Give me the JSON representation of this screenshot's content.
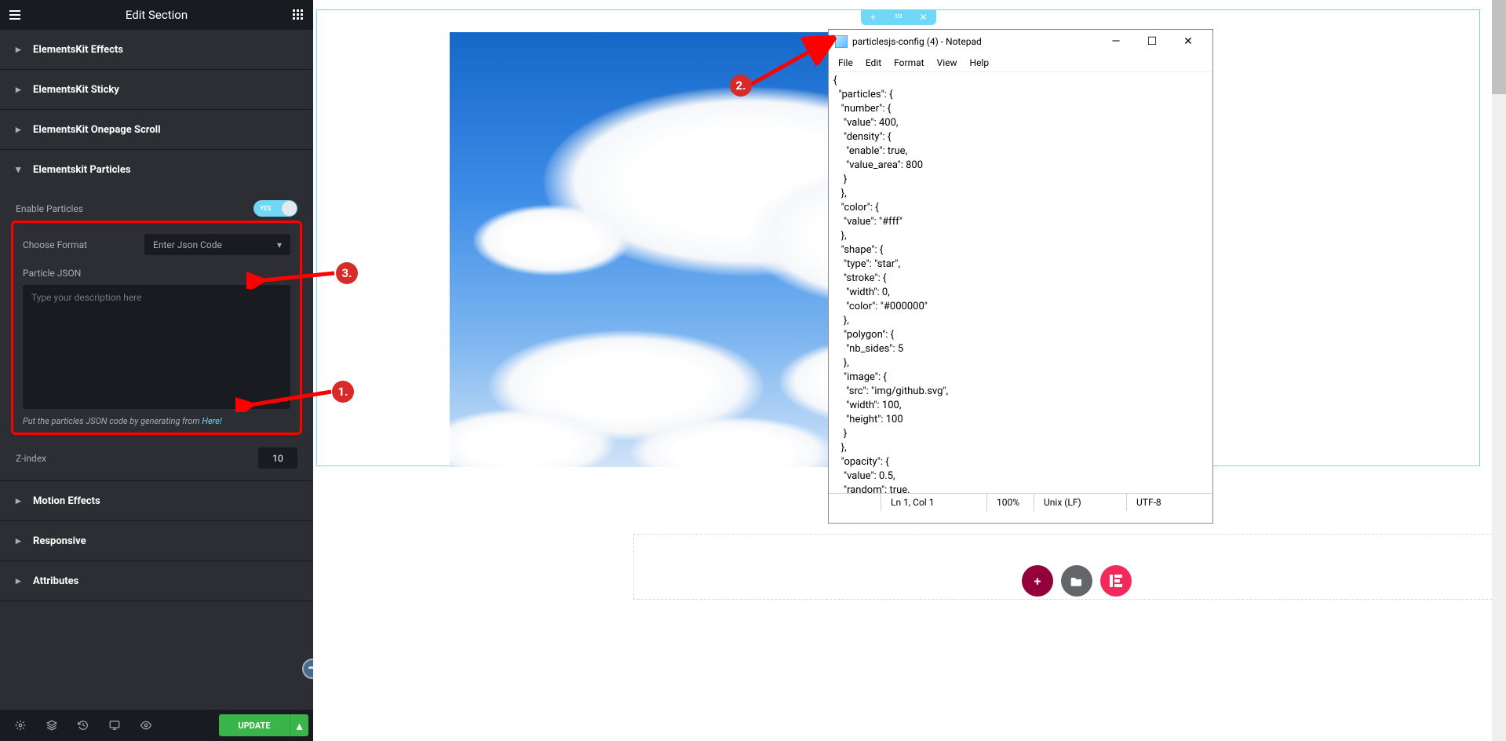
{
  "sidebar": {
    "title": "Edit Section",
    "sections": {
      "effects": "ElementsKit Effects",
      "sticky": "ElementsKit Sticky",
      "onepage": "ElementsKit Onepage Scroll",
      "particles": "Elementskit Particles",
      "motion": "Motion Effects",
      "responsive": "Responsive",
      "attributes": "Attributes"
    },
    "enable_particles_label": "Enable Particles",
    "toggle_yes": "YES",
    "choose_format_label": "Choose Format",
    "choose_format_value": "Enter Json Code",
    "particle_json_label": "Particle JSON",
    "particle_json_placeholder": "Type your description here",
    "helper_text_prefix": "Put the particles JSON code by generating from ",
    "helper_link": "Here!",
    "zindex_label": "Z-index",
    "zindex_value": "10",
    "update_button": "UPDATE"
  },
  "notepad": {
    "title": "particlesjs-config (4) - Notepad",
    "menu": {
      "file": "File",
      "edit": "Edit",
      "format": "Format",
      "view": "View",
      "help": "Help"
    },
    "content": "{\n  \"particles\": {\n   \"number\": {\n    \"value\": 400,\n    \"density\": {\n     \"enable\": true,\n     \"value_area\": 800\n    }\n   },\n   \"color\": {\n    \"value\": \"#fff\"\n   },\n   \"shape\": {\n    \"type\": \"star\",\n    \"stroke\": {\n     \"width\": 0,\n     \"color\": \"#000000\"\n    },\n    \"polygon\": {\n     \"nb_sides\": 5\n    },\n    \"image\": {\n     \"src\": \"img/github.svg\",\n     \"width\": 100,\n     \"height\": 100\n    }\n   },\n   \"opacity\": {\n    \"value\": 0.5,\n    \"random\": true,",
    "status": {
      "pos": "Ln 1, Col 1",
      "zoom": "100%",
      "eol": "Unix (LF)",
      "enc": "UTF-8"
    }
  },
  "callouts": {
    "one": "1.",
    "two": "2.",
    "three": "3."
  }
}
